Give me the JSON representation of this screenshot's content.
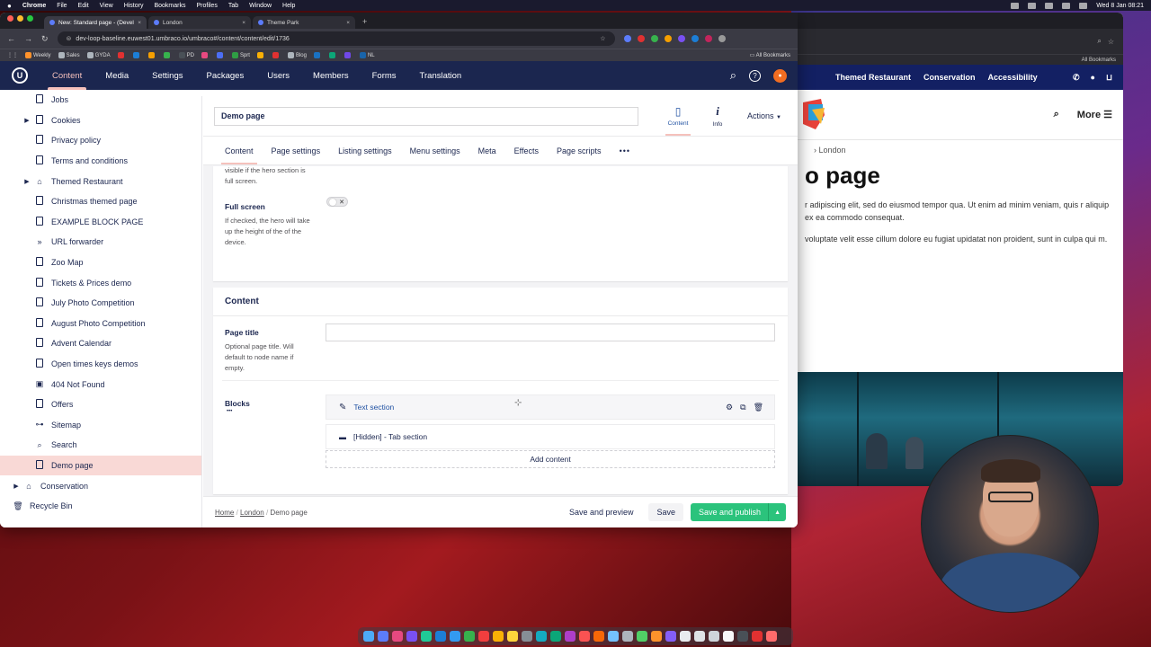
{
  "os": {
    "menubar": [
      "Chrome",
      "File",
      "Edit",
      "View",
      "History",
      "Bookmarks",
      "Profiles",
      "Tab",
      "Window",
      "Help"
    ],
    "clock": "Wed 8 Jan 08:21"
  },
  "browser": {
    "tabs": [
      {
        "label": "New: Standard page - (Devel"
      },
      {
        "label": "London"
      },
      {
        "label": "Theme Park"
      }
    ],
    "url": "dev-loop-baseline.euwest01.umbraco.io/umbraco#/content/content/edit/1736",
    "bookmarks": [
      "Weekly",
      "Sales",
      "GYDA",
      "PD",
      "Sprt",
      "Blog",
      "NL"
    ],
    "all_bookmarks": "All Bookmarks"
  },
  "umbraco": {
    "sections": [
      "Content",
      "Media",
      "Settings",
      "Packages",
      "Users",
      "Members",
      "Forms",
      "Translation"
    ],
    "active_section": "Content",
    "tree": [
      {
        "label": "Jobs",
        "icon": "doc",
        "caret": false
      },
      {
        "label": "Cookies",
        "icon": "doc",
        "caret": true
      },
      {
        "label": "Privacy policy",
        "icon": "doc",
        "caret": false
      },
      {
        "label": "Terms and conditions",
        "icon": "doc",
        "caret": false
      },
      {
        "label": "Themed Restaurant",
        "icon": "home",
        "caret": true
      },
      {
        "label": "Christmas themed page",
        "icon": "doc",
        "caret": false
      },
      {
        "label": "EXAMPLE BLOCK PAGE",
        "icon": "doc",
        "caret": false
      },
      {
        "label": "URL forwarder",
        "icon": "forward",
        "caret": false
      },
      {
        "label": "Zoo Map",
        "icon": "doc",
        "caret": false
      },
      {
        "label": "Tickets & Prices demo",
        "icon": "doc",
        "caret": false
      },
      {
        "label": "July Photo Competition",
        "icon": "doc",
        "caret": false
      },
      {
        "label": "August Photo Competition",
        "icon": "doc",
        "caret": false
      },
      {
        "label": "Advent Calendar",
        "icon": "doc",
        "caret": false
      },
      {
        "label": "Open times keys demos",
        "icon": "doc",
        "caret": false
      },
      {
        "label": "404 Not Found",
        "icon": "box",
        "caret": false
      },
      {
        "label": "Offers",
        "icon": "doc",
        "caret": false
      },
      {
        "label": "Sitemap",
        "icon": "sitemap",
        "caret": false
      },
      {
        "label": "Search",
        "icon": "search",
        "caret": false
      },
      {
        "label": "Demo page",
        "icon": "doc",
        "caret": false,
        "selected": true
      }
    ],
    "root_items": [
      {
        "label": "Conservation",
        "icon": "home"
      },
      {
        "label": "Recycle Bin",
        "icon": "trash"
      }
    ],
    "editor": {
      "node_name": "Demo page",
      "apps": [
        {
          "label": "Content"
        },
        {
          "label": "Info"
        }
      ],
      "actions_label": "Actions",
      "tabs": [
        "Content",
        "Page settings",
        "Listing settings",
        "Menu settings",
        "Meta",
        "Effects",
        "Page scripts"
      ],
      "more_label": "•••",
      "hero_note": "visible if the hero section is full screen.",
      "fullscreen": {
        "label": "Full screen",
        "description": "If checked, the hero will take up the height of the of the device.",
        "checked": false
      },
      "content_group": "Content",
      "page_title": {
        "label": "Page title",
        "description": "Optional page title. Will default to node name if empty.",
        "value": ""
      },
      "blocks": {
        "label": "Blocks",
        "dots": "•••",
        "items": [
          {
            "label": "Text section"
          },
          {
            "label": "[Hidden] - Tab section"
          }
        ],
        "add_label": "Add content"
      },
      "breadcrumb": [
        "Home",
        "London",
        "Demo page"
      ],
      "buttons": {
        "preview": "Save and preview",
        "save": "Save",
        "publish": "Save and publish"
      }
    }
  },
  "website": {
    "topnav": [
      "Themed Restaurant",
      "Conservation",
      "Accessibility"
    ],
    "more": "More",
    "breadcrumb": "London",
    "heading": "o page",
    "para1": "r adipiscing elit, sed do eiusmod tempor qua. Ut enim ad minim veniam, quis r aliquip ex ea commodo consequat.",
    "para2": "voluptate velit esse cillum dolore eu fugiat upidatat non proident, sunt in culpa qui m."
  },
  "colors": {
    "umbraco_header": "#1b264f",
    "accent": "#f5c1bc",
    "publish": "#2bc37c"
  }
}
